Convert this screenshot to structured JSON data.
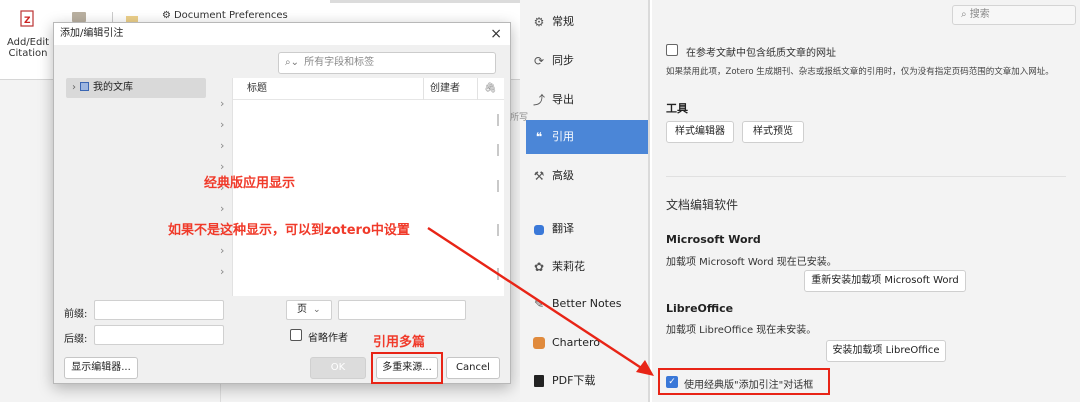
{
  "ribbon": {
    "add_edit_label": "Add/Edit\nCitation",
    "doc_prefs_label": "Document Preferences"
  },
  "dialog": {
    "title": "添加/编辑引注",
    "close": "×",
    "search_placeholder": "所有字段和标签",
    "library": "我的文库",
    "col_title": "标题",
    "col_creator": "创建者",
    "prefix_label": "前缀:",
    "suffix_label": "后缀:",
    "locator_select": "页",
    "omit_author": "省略作者",
    "show_editor": "显示编辑器...",
    "ok": "OK",
    "multiple_sources": "多重来源...",
    "cancel": "Cancel"
  },
  "annotations": {
    "classic_display": "经典版应用显示",
    "if_not": "如果不是这种显示，可以到zotero中设置",
    "cite_multiple": "引用多篇"
  },
  "settings": {
    "search_placeholder": "搜索",
    "nav": [
      {
        "label": "常规",
        "icon": "gear-icon"
      },
      {
        "label": "同步",
        "icon": "sync-icon"
      },
      {
        "label": "导出",
        "icon": "export-icon"
      },
      {
        "label": "引用",
        "icon": "cite-icon"
      },
      {
        "label": "高级",
        "icon": "advanced-icon"
      },
      {
        "label": "翻译",
        "icon": "translate-icon"
      },
      {
        "label": "茉莉花",
        "icon": "jasmine-icon"
      },
      {
        "label": "Better Notes",
        "icon": "notes-icon"
      },
      {
        "label": "Chartero",
        "icon": "chartero-icon"
      },
      {
        "label": "PDF下载",
        "icon": "pdf-icon"
      }
    ],
    "nav_fragment": "所写",
    "paper_url_checkbox": "在参考文献中包含纸质文章的网址",
    "paper_url_note": "如果禁用此项，Zotero 生成期刊、杂志或报纸文章的引用时，仅为没有指定页码范围的文章加入网址。",
    "tools_heading": "工具",
    "style_editor": "样式编辑器",
    "style_preview": "样式预览",
    "word_processors": "文档编辑软件",
    "ms_word_heading": "Microsoft Word",
    "ms_word_status": "加载项 Microsoft Word 现在已安装。",
    "ms_word_button": "重新安装加载项 Microsoft Word",
    "libre_heading": "LibreOffice",
    "libre_status": "加载项 LibreOffice 现在未安装。",
    "libre_button": "安装加载项 LibreOffice",
    "classic_checkbox": "使用经典版\"添加引注\"对话框"
  },
  "colors": {
    "accent": "#4b86d7",
    "annotation_red": "#f03a2a",
    "box_red": "#e82416"
  }
}
